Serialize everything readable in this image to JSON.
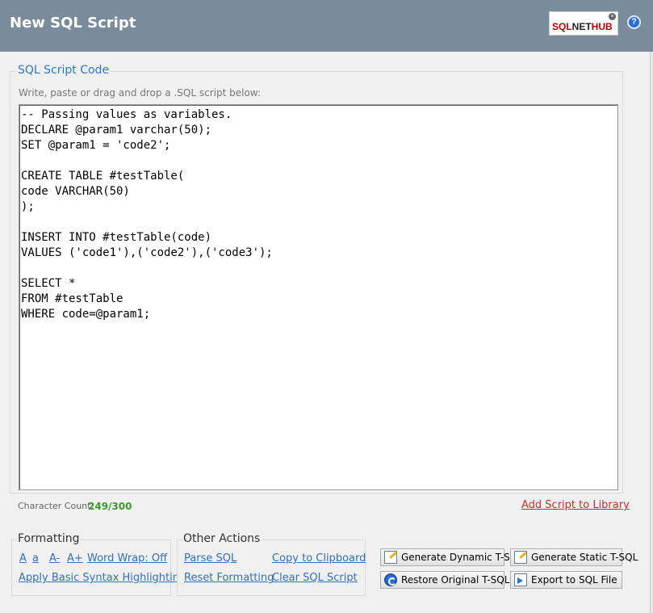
{
  "header": {
    "title": "New SQL Script",
    "logo": {
      "part1": "SQL",
      "part2": "NET",
      "part3": "HUB"
    },
    "help_icon": "?"
  },
  "script_section": {
    "legend": "SQL Script Code",
    "hint": "Write, paste or drag and drop a .SQL script below:",
    "code": "-- Passing values as variables.\nDECLARE @param1 varchar(50);\nSET @param1 = 'code2';\n\nCREATE TABLE #testTable(\ncode VARCHAR(50)\n);\n\nINSERT INTO #testTable(code)\nVALUES ('code1'),('code2'),('code3');\n\nSELECT *\nFROM #testTable\nWHERE code=@param1;"
  },
  "character_count": {
    "label": "Character Count:",
    "value": "249/300"
  },
  "add_to_library": "Add Script to Library",
  "formatting": {
    "legend": "Formatting",
    "font_large": "A",
    "font_small": "a",
    "font_decrease": "A-",
    "font_increase": "A+",
    "word_wrap": "Word Wrap: Off",
    "syntax_highlighting": "Apply Basic Syntax Highlighting"
  },
  "other_actions": {
    "legend": "Other Actions",
    "parse_sql": "Parse SQL",
    "copy_clipboard": "Copy to Clipboard",
    "reset_formatting": "Reset Formatting",
    "clear_script": "Clear SQL Script"
  },
  "buttons": {
    "generate_dynamic": "Generate Dynamic T-SQL",
    "generate_static": "Generate Static T-SQL",
    "restore_original": "Restore Original T-SQL",
    "export_sql": "Export to SQL File"
  }
}
